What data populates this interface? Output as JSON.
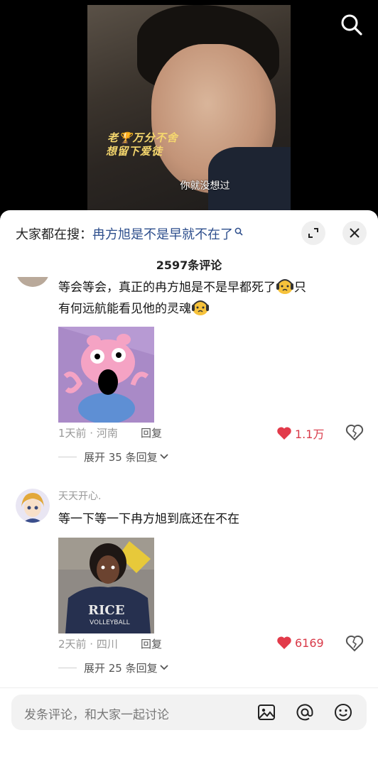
{
  "video": {
    "caption_line1": "老🏆万分不舍",
    "caption_line2": "想留下爱徒",
    "subtitle": "你就没想过"
  },
  "header": {
    "search_prefix": "大家都在搜：",
    "search_keyword": "冉方旭是不是早就不在了",
    "comment_count": "2597条评论"
  },
  "comments": [
    {
      "text_line1": "等会等会，真正的冉方旭是不是早都死了",
      "text_line1_tail": "只",
      "text_line2": "有何远航能看见他的灵魂",
      "time_location": "1天前 · 河南",
      "reply_label": "回复",
      "likes": "1.1万",
      "expand_label": "展开 35 条回复"
    },
    {
      "username": "天天开心.",
      "text": "等一下等一下冉方旭到底还在不在",
      "time_location": "2天前 · 四川",
      "reply_label": "回复",
      "likes": "6169",
      "expand_label": "展开 25 条回复"
    }
  ],
  "input": {
    "placeholder": "发条评论，和大家一起讨论"
  },
  "colors": {
    "like_red": "#d93a49",
    "keyword_blue": "#2d4e8c"
  }
}
